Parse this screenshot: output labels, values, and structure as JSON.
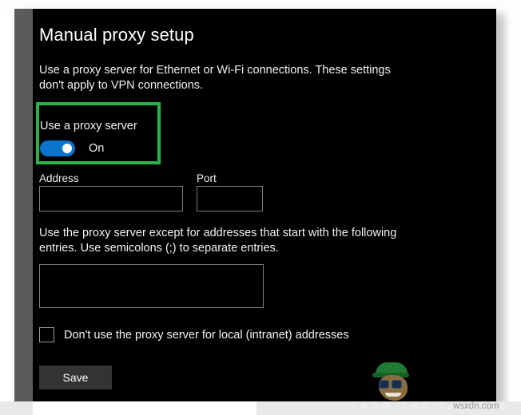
{
  "window": {
    "title": "Manual proxy setup"
  },
  "intro": {
    "text": "Use a proxy server for Ethernet or Wi-Fi connections. These settings don't apply to VPN connections."
  },
  "proxy_toggle": {
    "label": "Use a proxy server",
    "state": "On",
    "accent_color": "#0a74cd",
    "highlight_color": "#2cb24c"
  },
  "address_field": {
    "label": "Address",
    "value": "",
    "placeholder": ""
  },
  "port_field": {
    "label": "Port",
    "value": "",
    "placeholder": ""
  },
  "exceptions": {
    "description": "Use the proxy server except for addresses that start with the following entries. Use semicolons (;) to separate entries.",
    "value": "",
    "placeholder": ""
  },
  "local_bypass": {
    "label": "Don't use the proxy server for local (intranet) addresses",
    "checked": false
  },
  "actions": {
    "save_label": "Save"
  },
  "watermark": {
    "tagline": "FROM THE EXPERTS",
    "site": "wsxdn.com"
  }
}
